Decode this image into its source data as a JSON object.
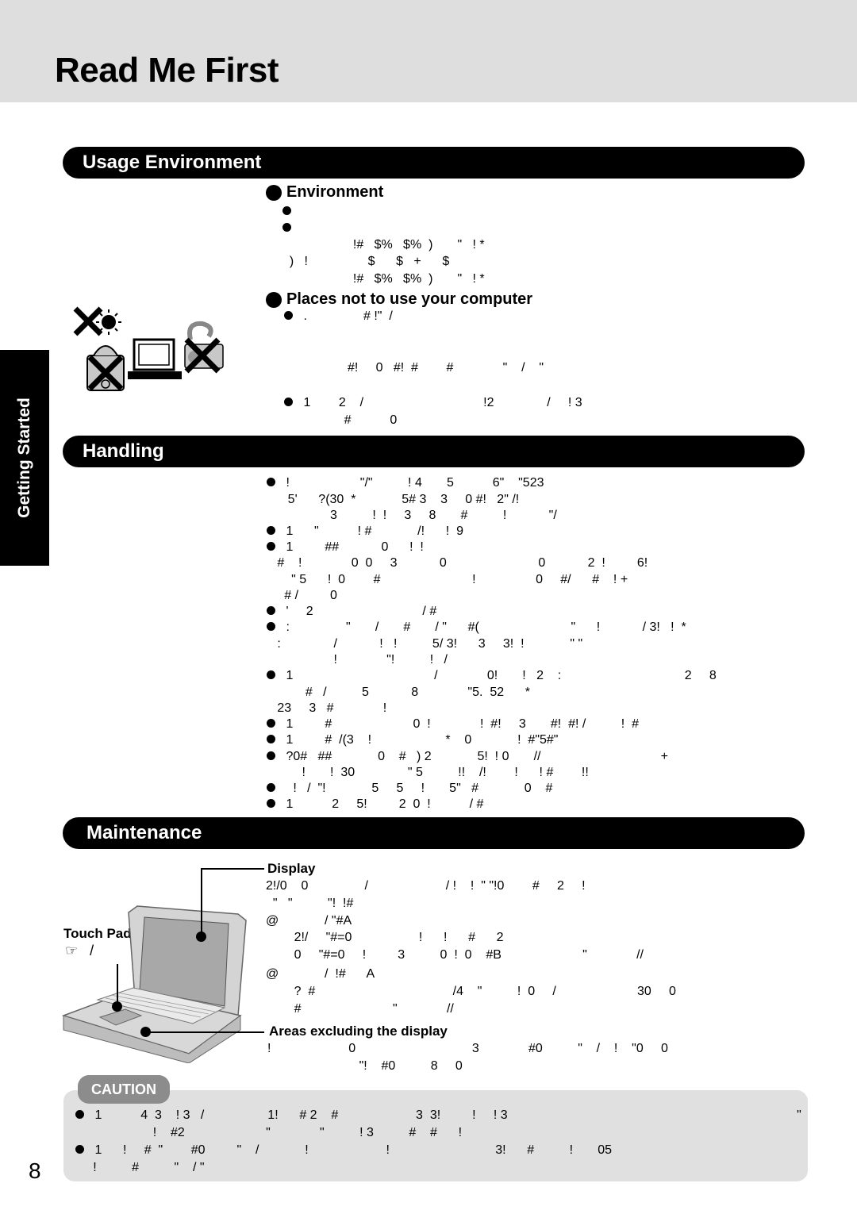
{
  "page": {
    "title": "Read Me First",
    "page_number": "8",
    "side_tab": "Getting Started"
  },
  "sections": {
    "usage_environment": "Usage Environment",
    "handling": "Handling",
    "maintenance": "Maintenance"
  },
  "environment": {
    "heading": "Environment",
    "lines": [
      "",
      "",
      "                    !#   $%   $%  )       \"   ! *",
      "  )   !                 $      $   +      $",
      "                    !#   $%   $%  )       \"   ! *"
    ]
  },
  "places": {
    "heading": "Places not to use your computer",
    "lines": [
      " .                # !\"  /",
      "                  #!     0   #!  #        #              \"    /    \"",
      " 1        2    /                                  !2               /     ! 3",
      "                 #           0"
    ]
  },
  "handling": {
    "lines": [
      " !                    \"/\"          ! 4       5           6\"    \"523",
      "      5'      ?(30  *             5# 3    3     0 #!   2\" /!",
      "                  3          !  !     3     8       #          !            \"/",
      " 1      \"           ! #             /!      !  9",
      " 1         ##            0      !  !",
      "   #    !              0  0     3            0                          0            2  !         6!",
      "       \" 5      !  0        #                          !                 0     #/      #    ! +",
      "     # /         0",
      " '     2                               / #",
      " :                \"       /       #       / \"      #(                          \"      !            / 3!   !  *",
      "   :               /            !   !          5/ 3!      3     3!  !             \" \"",
      "                   !              \"!          !   /",
      " 1                                        /              0!       !   2    :                                   2     8",
      "           #   /          5            8              \"5.  52      *",
      "   23     3   #              !",
      " 1         #                       0  !              !  #!     3       #!  #! /          !  #",
      " 1         #  /(3    !                     *    0             !  #\"5#\"",
      " ?0#   ##             0    #   ) 2             5!  ! 0       //                                  +",
      "          !       !  30               \" 5          !!    /!        !      ! #        !!",
      "   !   /  \"!             5     5     !       5\"   #             0    #",
      " 1           2     5!         2  0  !           / #"
    ]
  },
  "maintenance": {
    "display_label": "Display",
    "display_lines": [
      "2!/0    0                /                      / !    !  \" \"!0        #     2     !",
      "  \"   \"          \"!  !#",
      "@             / \"#A",
      "        2!/     \"#=0                   !      !      #      2",
      "        0     \"#=0     !         3          0  !  0    #B                       \"              //",
      "@             /  !#      A",
      "        ?  #                                       /4    \"          !  0     /                       30     0",
      "        #                          \"              //"
    ],
    "touch_pad_label": "Touch Pad",
    "touch_pad_ref": "/",
    "areas_label": "Areas excluding the display",
    "areas_lines": [
      "!                      0                                 3              #0          \"    /    !    \"0     0",
      "                          \"!    #0          8     0"
    ]
  },
  "caution": {
    "tag": "CAUTION",
    "lines": [
      " 1           4  3    ! 3   /                  1!      # 2    #                      3  3!         !     ! 3                                                                                  \"",
      "                      !    #2                       \"              \"          ! 3          #    #      !",
      " 1      !     #  \"        #0         \"    /             !                      !                              3!      #          !       05",
      "     !          #          \"    / \""
    ]
  },
  "icons": {
    "hand_pointer": "☞"
  }
}
